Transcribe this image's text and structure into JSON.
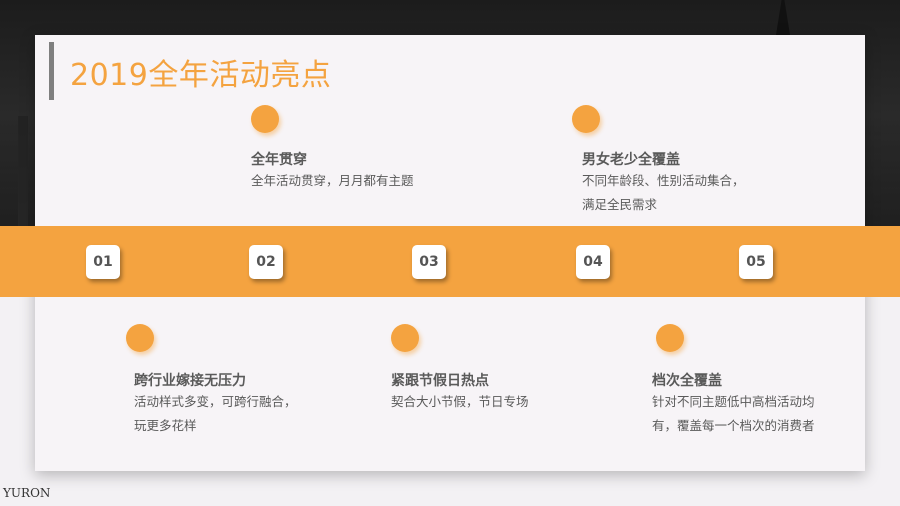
{
  "title": "2019全年活动亮点",
  "steps": [
    {
      "num": "01",
      "heading": "跨行业嫁接无压力",
      "desc": [
        "活动样式多变，可跨行融合，",
        "玩更多花样"
      ]
    },
    {
      "num": "02",
      "heading": "全年贯穿",
      "desc": [
        "全年活动贯穿，月月都有主题"
      ]
    },
    {
      "num": "03",
      "heading": "紧跟节假日热点",
      "desc": [
        "契合大小节假，节日专场"
      ]
    },
    {
      "num": "04",
      "heading": "男女老少全覆盖",
      "desc": [
        "不同年龄段、性别活动集合，",
        "满足全民需求"
      ]
    },
    {
      "num": "05",
      "heading": "档次全覆盖",
      "desc": [
        "针对不同主题低中高档活动均",
        "有，覆盖每一个档次的消费者"
      ]
    }
  ],
  "watermark": "YURON",
  "colors": {
    "accent": "#f4a340",
    "text": "#5a5a5a",
    "title_bar": "#7f7f7f"
  }
}
